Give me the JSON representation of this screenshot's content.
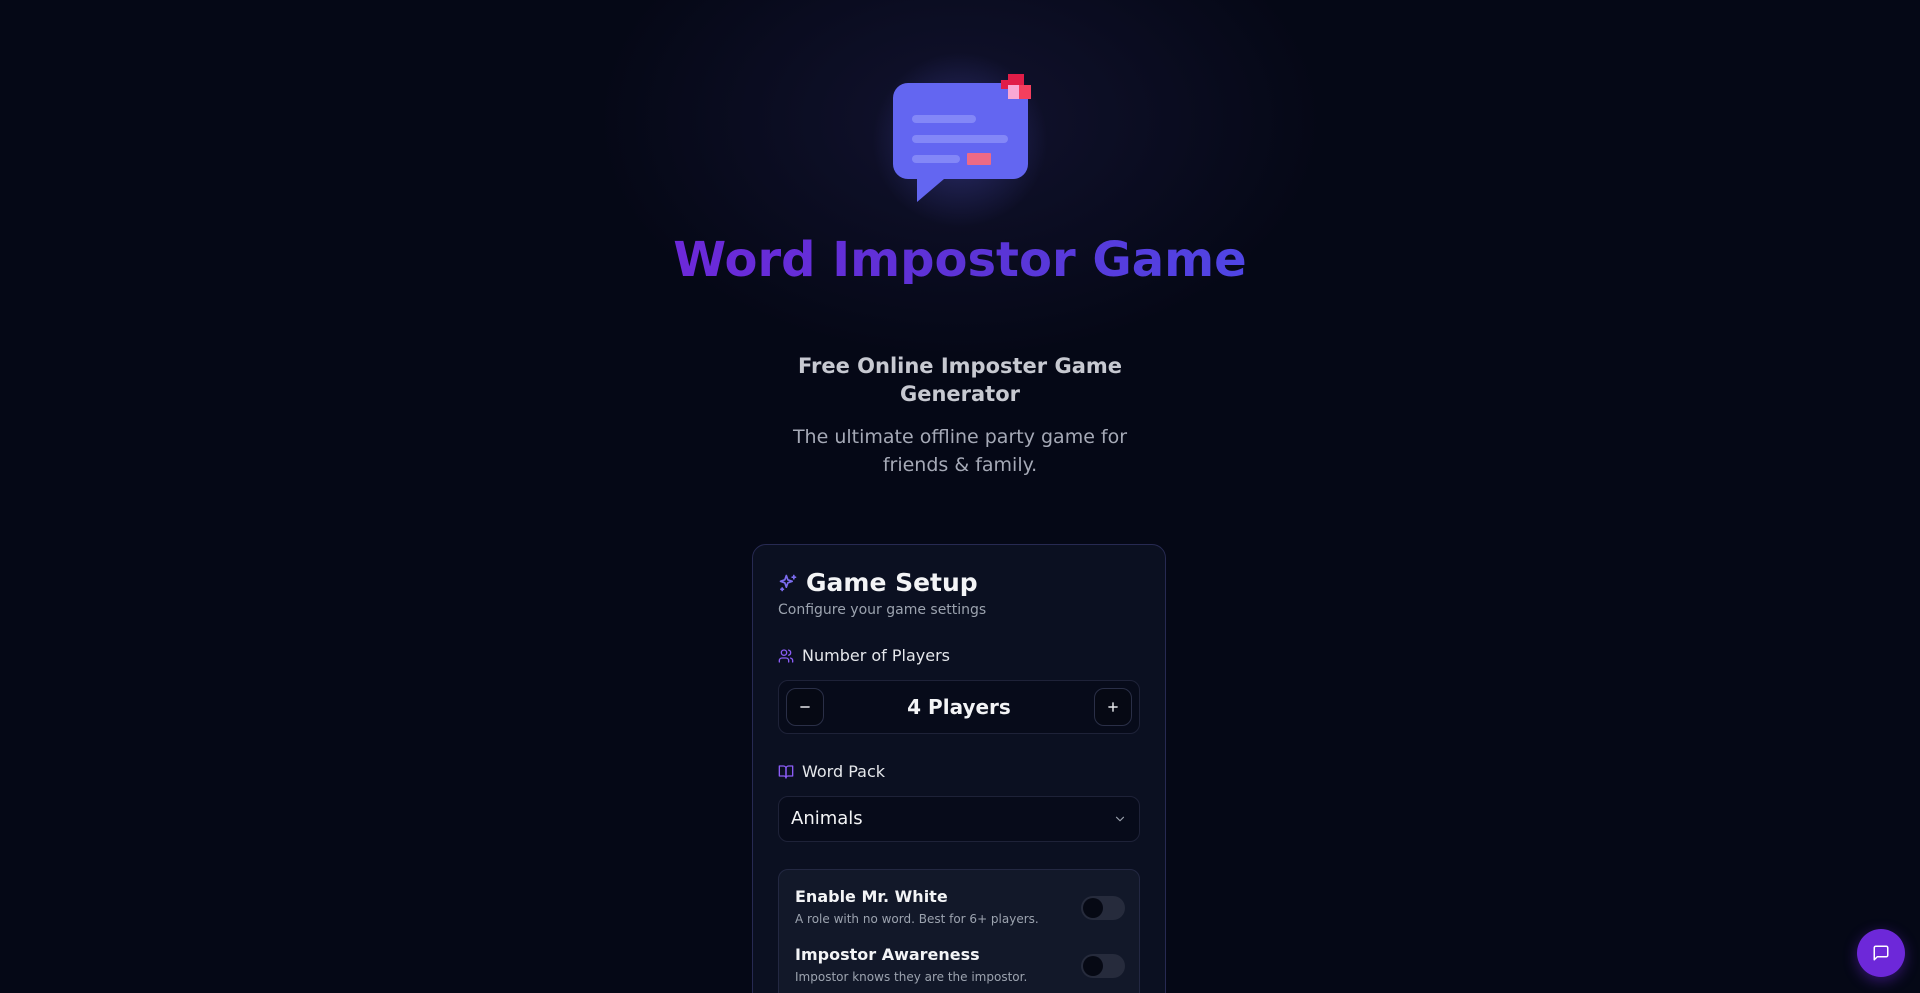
{
  "hero": {
    "title": "Word Impostor Game",
    "subtitle": "Free Online Imposter Game Generator",
    "tagline": "The ultimate offline party game for friends & family."
  },
  "setup": {
    "title": "Game Setup",
    "description": "Configure your game settings",
    "players": {
      "label": "Number of Players",
      "value": "4 Players",
      "count": 4
    },
    "word_pack": {
      "label": "Word Pack",
      "selected": "Animals"
    },
    "options": [
      {
        "title": "Enable Mr. White",
        "description": "A role with no word. Best for 6+ players.",
        "enabled": false
      },
      {
        "title": "Impostor Awareness",
        "description": "Impostor knows they are the impostor.",
        "enabled": false
      }
    ]
  },
  "icons": {
    "logo": "chat-bubble-logo-icon",
    "setup": "sparkles-icon",
    "players": "users-icon",
    "word_pack": "book-open-icon",
    "minus": "minus-icon",
    "plus": "plus-icon",
    "select": "chevron-down-icon",
    "chat": "message-square-icon"
  },
  "colors": {
    "background": "#050816",
    "accent": "#6d28d9",
    "logo_bubble": "#6366f1",
    "logo_highlight": "#f43f5e"
  }
}
